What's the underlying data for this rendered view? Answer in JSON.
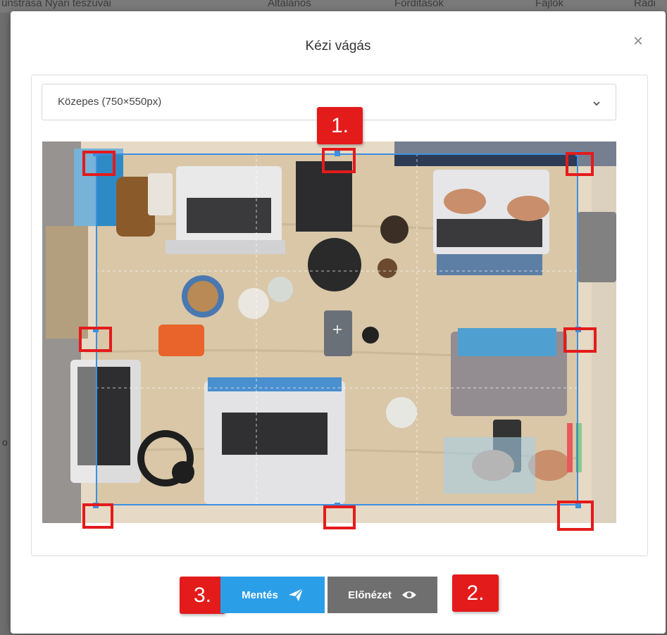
{
  "background": {
    "topbar_items": [
      "ünstrasa Nyari teszuvai",
      "Altalanos",
      "Forditasok",
      "Fajlok",
      "Radi"
    ],
    "left_text": "o"
  },
  "modal": {
    "title": "Kézi vágás",
    "close_symbol": "×",
    "size_select": {
      "value": "Közepes (750×550px)"
    },
    "buttons": {
      "save_label": "Mentés",
      "preview_label": "Előnézet"
    },
    "annotations": {
      "one": "1.",
      "two": "2.",
      "three": "3."
    }
  },
  "colors": {
    "accent": "#2b9ee8",
    "crop_border": "#3d8fe0",
    "annotation_red": "#e41b1b",
    "preview_button": "#6f6f6f"
  },
  "icons": [
    "close-icon",
    "chevron-down-icon",
    "paper-plane-icon",
    "eye-icon"
  ]
}
